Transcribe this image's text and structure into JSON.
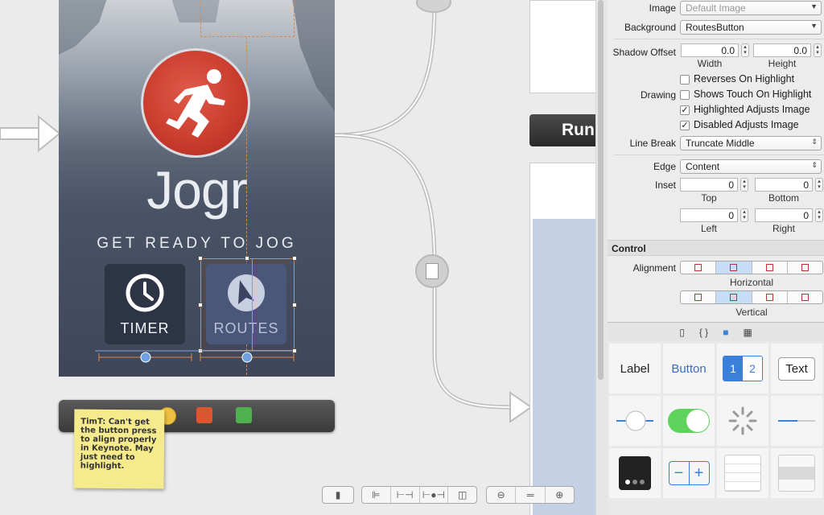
{
  "phone": {
    "app_title": "Jogr",
    "tagline": "GET READY TO JOG",
    "timer_label": "TIMER",
    "routes_label": "ROUTES"
  },
  "sticky_note": {
    "text": "TimT: Can't get the button press to align properly in Keynote. May just need to highlight."
  },
  "scene": {
    "run_button_label": "Run"
  },
  "inspector": {
    "image_label": "Image",
    "image_value": "Default Image",
    "background_label": "Background",
    "background_value": "RoutesButton",
    "shadow_offset_label": "Shadow Offset",
    "shadow_width": "0.0",
    "shadow_height": "0.0",
    "width_label": "Width",
    "height_label": "Height",
    "reverses_on_highlight": "Reverses On Highlight",
    "drawing_label": "Drawing",
    "shows_touch_on_highlight": "Shows Touch On Highlight",
    "highlighted_adjusts_image": "Highlighted Adjusts Image",
    "disabled_adjusts_image": "Disabled Adjusts Image",
    "line_break_label": "Line Break",
    "line_break_value": "Truncate Middle",
    "edge_label": "Edge",
    "edge_value": "Content",
    "inset_label": "Inset",
    "inset_top": "0",
    "inset_bottom": "0",
    "inset_left": "0",
    "inset_right": "0",
    "top_label": "Top",
    "bottom_label": "Bottom",
    "left_label": "Left",
    "right_label": "Right",
    "control_section": "Control",
    "alignment_label": "Alignment",
    "horizontal_label": "Horizontal",
    "vertical_label": "Vertical"
  },
  "library_tabs": [
    "{ }"
  ],
  "library": {
    "label_item": "Label",
    "button_item": "Button",
    "segment_one": "1",
    "segment_two": "2",
    "text_item": "Text"
  },
  "colors": {
    "accent_blue": "#3a7fd9",
    "switch_green": "#5fd35c",
    "run_red": "#c93b2d"
  }
}
